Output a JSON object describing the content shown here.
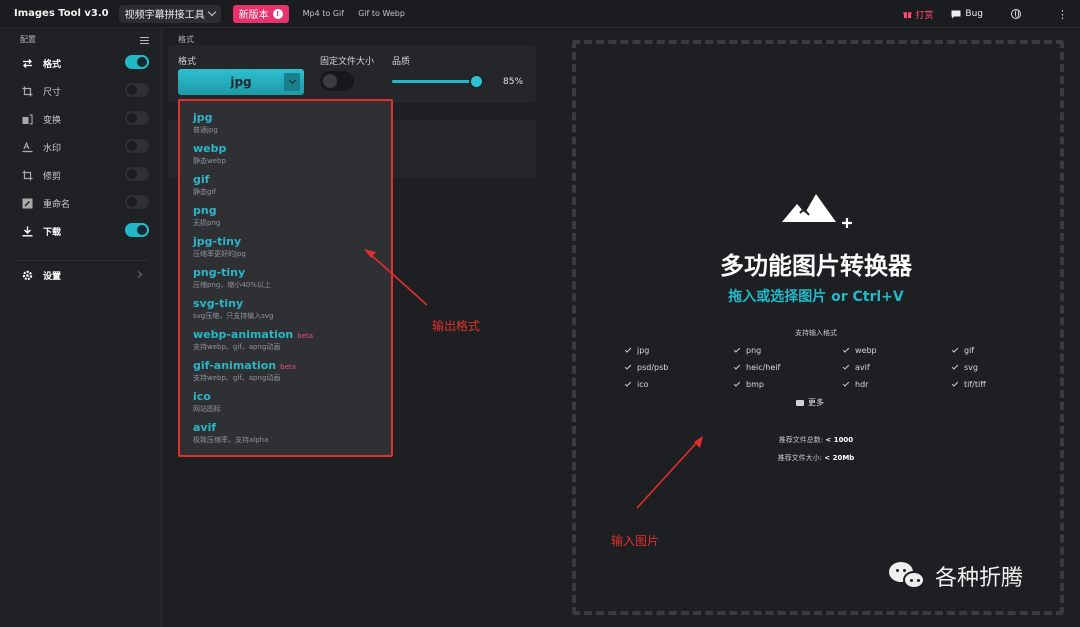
{
  "topbar": {
    "app_title": "Images Tool v3.0",
    "tool_select": "视频字幕拼接工具",
    "new_version": "新版本",
    "new_version_badge": "!",
    "links": [
      "Mp4 to Gif",
      "Gif to Webp"
    ],
    "tip_label": "打赏",
    "bug_label": "Bug"
  },
  "sidebar": {
    "header": "配置",
    "items": [
      {
        "label": "格式",
        "on": true,
        "icon": "swap-icon"
      },
      {
        "label": "尺寸",
        "on": false,
        "icon": "crop-icon"
      },
      {
        "label": "变换",
        "on": false,
        "icon": "transform-icon"
      },
      {
        "label": "水印",
        "on": false,
        "icon": "watermark-icon"
      },
      {
        "label": "修剪",
        "on": false,
        "icon": "trim-icon"
      },
      {
        "label": "重命名",
        "on": false,
        "icon": "rename-icon"
      },
      {
        "label": "下载",
        "on": true,
        "icon": "download-icon"
      }
    ],
    "settings_label": "设置"
  },
  "config": {
    "section_title": "格式",
    "format_label": "格式",
    "format_value": "jpg",
    "fixed_size_label": "固定文件大小",
    "quality_label": "品质",
    "quality_value": "85%",
    "quality_fraction": 0.85
  },
  "dropdown": {
    "options": [
      {
        "name": "jpg",
        "desc": "普通jpg",
        "beta": ""
      },
      {
        "name": "webp",
        "desc": "静态webp",
        "beta": ""
      },
      {
        "name": "gif",
        "desc": "静态gif",
        "beta": ""
      },
      {
        "name": "png",
        "desc": "无损png",
        "beta": ""
      },
      {
        "name": "jpg-tiny",
        "desc": "压缩率更好的jpg",
        "beta": ""
      },
      {
        "name": "png-tiny",
        "desc": "压缩png，缩小40%以上",
        "beta": ""
      },
      {
        "name": "svg-tiny",
        "desc": "svg压缩，只支持输入svg",
        "beta": ""
      },
      {
        "name": "webp-animation",
        "desc": "支持webp、gif、apng动画",
        "beta": "beta"
      },
      {
        "name": "gif-animation",
        "desc": "支持webp、gif、apng动画",
        "beta": "beta"
      },
      {
        "name": "ico",
        "desc": "网站图标",
        "beta": ""
      },
      {
        "name": "avif",
        "desc": "极致压缩率，支持alpha",
        "beta": ""
      }
    ]
  },
  "dropzone": {
    "title": "多功能图片转换器",
    "subtitle": "拖入或选择图片 or Ctrl+V",
    "supported_label": "支持输入格式",
    "formats": [
      "jpg",
      "png",
      "webp",
      "gif",
      "psd/psb",
      "heic/heif",
      "avif",
      "svg",
      "ico",
      "bmp",
      "hdr",
      "tif/tiff"
    ],
    "more_label": "更多",
    "rec_count_label": "推荐文件总数:",
    "rec_count_value": "< 1000",
    "rec_size_label": "推荐文件大小:",
    "rec_size_value": "< 20Mb"
  },
  "annotations": {
    "output_format": "输出格式",
    "input_image": "输入图片"
  },
  "watermark": {
    "text": "各种折腾"
  },
  "colors": {
    "accent": "#22b8c8",
    "annotation_red": "#e0302b",
    "new_version_pink": "#e8326e"
  }
}
